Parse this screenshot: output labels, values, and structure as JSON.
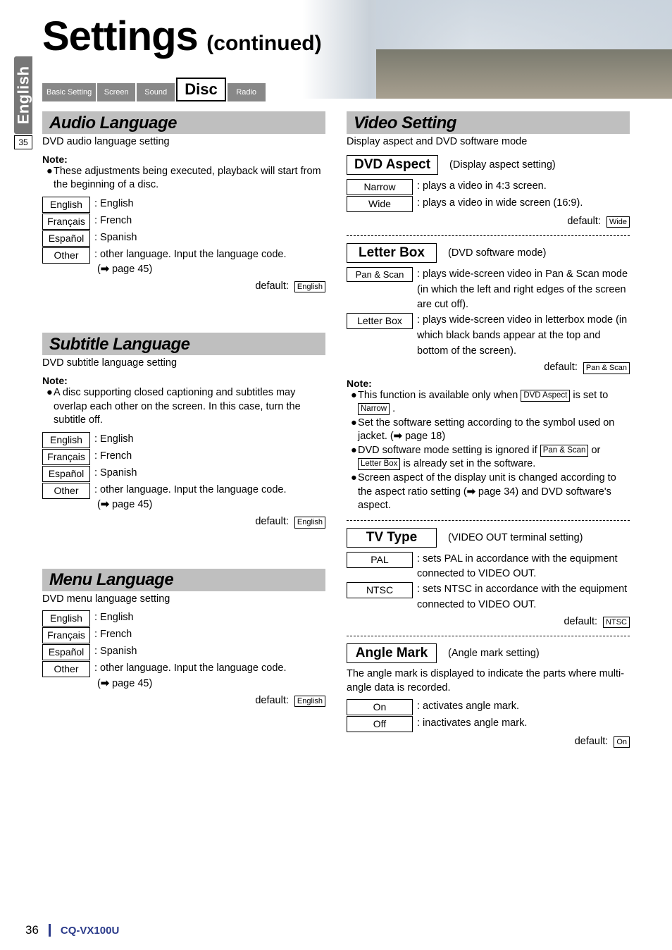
{
  "page": {
    "title_main": "Settings",
    "title_cont": "(continued)",
    "side_lang": "English",
    "side_page_ref": "35",
    "page_number": "36",
    "model": "CQ-VX100U"
  },
  "tabs": {
    "basic": "Basic Setting",
    "screen": "Screen",
    "sound": "Sound",
    "disc": "Disc",
    "radio": "Radio"
  },
  "audio_lang": {
    "title": "Audio Language",
    "sub": "DVD audio language setting",
    "note_label": "Note:",
    "note1": "These adjustments being executed, playback will start from the beginning of a disc.",
    "opts": {
      "english_label": "English",
      "english_desc": ": English",
      "francais_label": "Français",
      "francais_desc": ": French",
      "espanol_label": "Español",
      "espanol_desc": ": Spanish",
      "other_label": "Other",
      "other_desc": ": other language. Input the language code.",
      "other_ref": "page 45)"
    },
    "default_label": "default:",
    "default_value": "English"
  },
  "subtitle_lang": {
    "title": "Subtitle Language",
    "sub": "DVD subtitle language setting",
    "note_label": "Note:",
    "note1": "A disc supporting closed captioning and subtitles may overlap each other on the screen. In this case, turn the subtitle off.",
    "opts": {
      "english_label": "English",
      "english_desc": ": English",
      "francais_label": "Français",
      "francais_desc": ": French",
      "espanol_label": "Español",
      "espanol_desc": ": Spanish",
      "other_label": "Other",
      "other_desc": ": other language. Input the language code.",
      "other_ref": "page 45)"
    },
    "default_label": "default:",
    "default_value": "English"
  },
  "menu_lang": {
    "title": "Menu Language",
    "sub": "DVD menu language setting",
    "opts": {
      "english_label": "English",
      "english_desc": ": English",
      "francais_label": "Français",
      "francais_desc": ": French",
      "espanol_label": "Español",
      "espanol_desc": ": Spanish",
      "other_label": "Other",
      "other_desc": ": other language. Input the language code.",
      "other_ref": "page 45)"
    },
    "default_label": "default:",
    "default_value": "English"
  },
  "video": {
    "title": "Video Setting",
    "sub": "Display aspect and DVD software mode",
    "dvd_aspect": {
      "title": "DVD Aspect",
      "paren": "(Display aspect setting)",
      "narrow_label": "Narrow",
      "narrow_desc": ": plays a video in 4:3 screen.",
      "wide_label": "Wide",
      "wide_desc": ": plays a video in wide screen (16:9).",
      "default_label": "default:",
      "default_value": "Wide"
    },
    "letter_box": {
      "title": "Letter Box",
      "paren": "(DVD software mode)",
      "pan_label": "Pan & Scan",
      "pan_desc": ": plays wide-screen video in Pan & Scan mode (in which the left and right edges of the screen are cut off).",
      "lb_label": "Letter Box",
      "lb_desc": ": plays wide-screen video in letterbox mode (in which black bands appear at the top and bottom of the screen).",
      "default_label": "default:",
      "default_value": "Pan & Scan"
    },
    "note_label": "Note:",
    "note_b1a": "This function is available only when ",
    "note_b1_box": "DVD Aspect",
    "note_b1b": " is set to ",
    "note_b1_box2": "Narrow",
    "note_b1c": " .",
    "note_b2a": "Set the software setting according to the symbol used on jacket. (",
    "note_b2b": " page 18)",
    "note_b3a": "DVD software mode setting is ignored if ",
    "note_b3_box1": "Pan & Scan",
    "note_b3b": " or ",
    "note_b3_box2": "Letter Box",
    "note_b3c": " is already set in the software.",
    "note_b4a": "Screen aspect of the display unit is changed according to the aspect ratio setting (",
    "note_b4b": " page 34) and DVD software's aspect.",
    "tv_type": {
      "title": "TV Type",
      "paren": "(VIDEO OUT terminal setting)",
      "pal_label": "PAL",
      "pal_desc": ": sets PAL in accordance with the equipment connected to VIDEO OUT.",
      "ntsc_label": "NTSC",
      "ntsc_desc": ": sets NTSC in accordance with the equipment connected to VIDEO OUT.",
      "default_label": "default:",
      "default_value": "NTSC"
    },
    "angle": {
      "title": "Angle Mark",
      "paren": "(Angle mark setting)",
      "desc": "The angle mark is displayed to indicate the parts where multi-angle data is recorded.",
      "on_label": "On",
      "on_desc": ": activates angle mark.",
      "off_label": "Off",
      "off_desc": ": inactivates angle mark.",
      "default_label": "default:",
      "default_value": "On"
    }
  }
}
